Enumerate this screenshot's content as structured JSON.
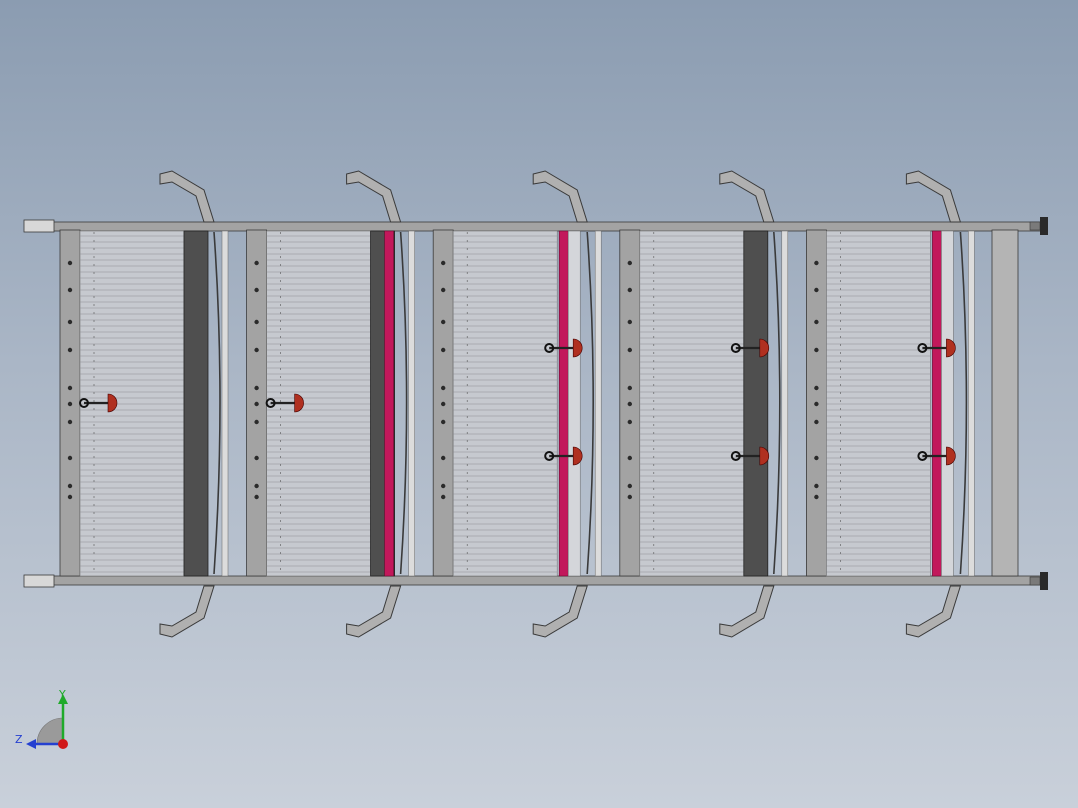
{
  "view": {
    "background_top": "#8b9cb1",
    "background_bottom": "#c9d0da"
  },
  "model": {
    "module_count": 5,
    "frame_color": "#a3a3a3",
    "frame_edge_color": "#3a3a3a",
    "mesh_color": "#c6c9cf",
    "dark_roller_color": "#4f4f4f",
    "seal_color": "#c2185b",
    "handle_accent_color": "#b03020",
    "modules": [
      {
        "divider": "dark",
        "handles": 1
      },
      {
        "divider": "dark+magenta",
        "handles": 1
      },
      {
        "divider": "magenta",
        "handles": 2
      },
      {
        "divider": "dark",
        "handles": 2
      },
      {
        "divider": "magenta",
        "handles": 2
      }
    ]
  },
  "triad": {
    "axis_y_label": "Y",
    "axis_z_label": "Z",
    "y_color": "#1faa2a",
    "z_color": "#2540d0",
    "x_color": "#d01818"
  }
}
